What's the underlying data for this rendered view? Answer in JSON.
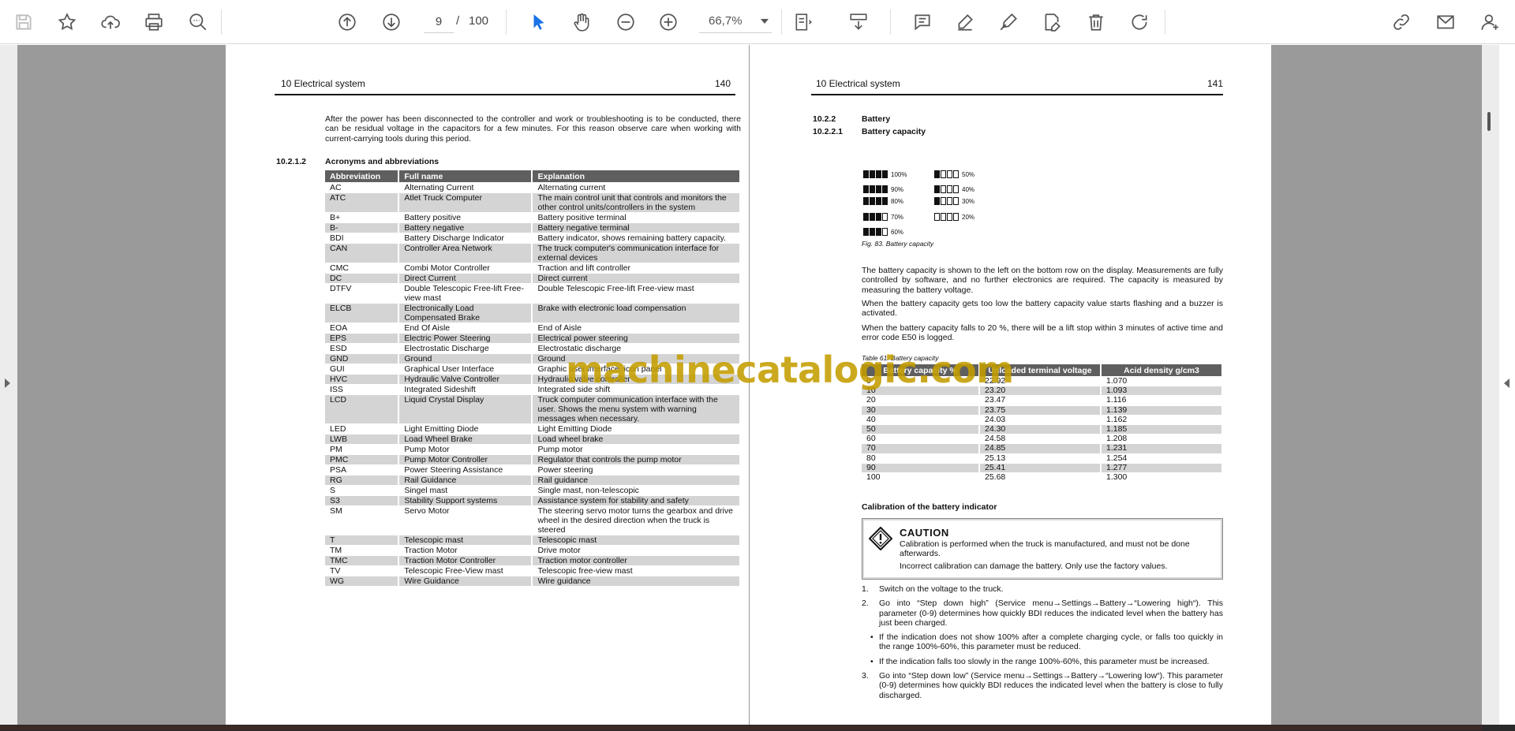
{
  "toolbar": {
    "left_icons": [
      "save-icon",
      "star-icon",
      "cloud-upload-icon",
      "print-icon",
      "zoom-search-icon"
    ],
    "nav_icons": [
      "page-up-icon",
      "page-down-icon"
    ],
    "page_current": "9",
    "page_sep": "/",
    "page_total": "100",
    "tool_icons": [
      "select-cursor-icon",
      "hand-icon",
      "zoom-out-icon",
      "zoom-in-icon"
    ],
    "zoom": "66,7%",
    "right_icons": [
      "fit-page-icon",
      "scroll-mode-icon",
      "comment-icon",
      "highlight-icon",
      "sign-icon",
      "edit-text-icon",
      "delete-icon",
      "rotate-icon",
      "share-link-icon",
      "email-icon",
      "add-user-icon"
    ],
    "accent_color": "#1a73e8"
  },
  "watermark": "machinecatalogic.com",
  "left_page": {
    "header_title": "10 Electrical system",
    "header_page": "140",
    "intro": "After the power has been disconnected to the controller and work or troubleshooting is to be conducted, there can be residual voltage in the capacitors for a few minutes. For this reason observe care when working with current-carrying tools during this period.",
    "section_num": "10.2.1.2",
    "section_title": "Acronyms and abbreviations",
    "table_headers": [
      "Abbreviation",
      "Full name",
      "Explanation"
    ],
    "table_rows": [
      [
        "AC",
        "Alternating Current",
        "Alternating current"
      ],
      [
        "ATC",
        "Atlet Truck Computer",
        "The main control unit that controls and monitors the other control units/controllers in the system"
      ],
      [
        "B+",
        "Battery positive",
        "Battery positive terminal"
      ],
      [
        "B-",
        "Battery negative",
        "Battery negative terminal"
      ],
      [
        "BDI",
        "Battery Discharge Indicator",
        "Battery indicator, shows remaining battery capacity."
      ],
      [
        "CAN",
        "Controller Area Network",
        "The truck computer's communication interface for external devices"
      ],
      [
        "CMC",
        "Combi Motor Controller",
        "Traction and lift controller"
      ],
      [
        "DC",
        "Direct Current",
        "Direct current"
      ],
      [
        "DTFV",
        "Double Telescopic Free-lift Free-view mast",
        "Double Telescopic Free-lift Free-view mast"
      ],
      [
        "ELCB",
        "Electronically Load Compensated Brake",
        "Brake with electronic load compensation"
      ],
      [
        "EOA",
        "End Of Aisle",
        "End of Aisle"
      ],
      [
        "EPS",
        "Electric Power Steering",
        "Electrical power steering"
      ],
      [
        "ESD",
        "Electrostatic Discharge",
        "Electrostatic discharge"
      ],
      [
        "GND",
        "Ground",
        "Ground"
      ],
      [
        "GUI",
        "Graphical User Interface",
        "Graphic user interface, icon panel"
      ],
      [
        "HVC",
        "Hydraulic Valve Controller",
        "Hydraulic valve controller"
      ],
      [
        "ISS",
        "Integrated Sideshift",
        "Integrated side shift"
      ],
      [
        "LCD",
        "Liquid Crystal Display",
        "Truck computer communication interface with the user. Shows the menu system with warning messages when necessary."
      ],
      [
        "LED",
        "Light Emitting Diode",
        "Light Emitting Diode"
      ],
      [
        "LWB",
        "Load Wheel Brake",
        "Load wheel brake"
      ],
      [
        "PM",
        "Pump Motor",
        "Pump motor"
      ],
      [
        "PMC",
        "Pump Motor Controller",
        "Regulator that controls the pump motor"
      ],
      [
        "PSA",
        "Power Steering Assistance",
        "Power steering"
      ],
      [
        "RG",
        "Rail Guidance",
        "Rail guidance"
      ],
      [
        "S",
        "Singel mast",
        "Single mast, non-telescopic"
      ],
      [
        "S3",
        "Stability Support systems",
        "Assistance system for stability and safety"
      ],
      [
        "SM",
        "Servo Motor",
        "The steering servo motor turns the gearbox and drive wheel in the desired direction when the truck is steered"
      ],
      [
        "T",
        "Telescopic mast",
        "Telescopic mast"
      ],
      [
        "TM",
        "Traction Motor",
        "Drive motor"
      ],
      [
        "TMC",
        "Traction Motor Controller",
        "Traction motor controller"
      ],
      [
        "TV",
        "Telescopic Free-View mast",
        "Telescopic free-view mast"
      ],
      [
        "WG",
        "Wire Guidance",
        "Wire guidance"
      ]
    ]
  },
  "right_page": {
    "header_title": "10 Electrical system",
    "header_page": "141",
    "sec1_num": "10.2.2",
    "sec1_title": "Battery",
    "sec2_num": "10.2.2.1",
    "sec2_title": "Battery capacity",
    "battery_levels": [
      {
        "label": "100%",
        "filled": 4
      },
      {
        "label": "90%",
        "filled": 4
      },
      {
        "label": "80%",
        "filled": 4
      },
      {
        "label": "70%",
        "filled": 3
      },
      {
        "label": "60%",
        "filled": 3
      },
      {
        "label": "50%",
        "filled": 1
      },
      {
        "label": "40%",
        "filled": 1
      },
      {
        "label": "30%",
        "filled": 1
      },
      {
        "label": "20%",
        "filled": 0
      }
    ],
    "fig_caption": "Fig. 83. Battery capacity",
    "para1": "The battery capacity is shown to the left on the bottom row on the display. Measurements are fully controlled by software, and no further electronics are required. The capacity is measured by measuring the battery voltage.",
    "para2": "When the battery capacity gets too low the battery capacity value starts flashing and a buzzer is activated.",
    "para3": "When the battery capacity falls to 20 %, there will be a lift stop within 3 minutes of active time and error code E50 is logged.",
    "table_caption": "Table 61. Battery capacity",
    "table_headers": [
      "Battery capacity %",
      "Unloaded terminal voltage",
      "Acid density g/cm3"
    ],
    "table_rows": [
      [
        "0",
        "22.92",
        "1.070"
      ],
      [
        "10",
        "23.20",
        "1.093"
      ],
      [
        "20",
        "23.47",
        "1.116"
      ],
      [
        "30",
        "23.75",
        "1.139"
      ],
      [
        "40",
        "24.03",
        "1.162"
      ],
      [
        "50",
        "24.30",
        "1.185"
      ],
      [
        "60",
        "24.58",
        "1.208"
      ],
      [
        "70",
        "24.85",
        "1.231"
      ],
      [
        "80",
        "25.13",
        "1.254"
      ],
      [
        "90",
        "25.41",
        "1.277"
      ],
      [
        "100",
        "25.68",
        "1.300"
      ]
    ],
    "calib_title": "Calibration of the battery indicator",
    "caution_title": "CAUTION",
    "caution_line1": "Calibration is performed when the truck is manufactured, and must not be done afterwards.",
    "caution_line2": "Incorrect calibration can damage the battery. Only use the factory values.",
    "step1_num": "1.",
    "step1": "Switch on the voltage to the truck.",
    "step2_num": "2.",
    "step2": "Go into “Step down high” (Service menu→Settings→Battery→“Lowering high“). This parameter (0-9) determines how quickly BDI reduces the indicated level when the battery has just been charged.",
    "bullet1": "If the indication does not show 100% after a complete charging cycle, or falls too quickly in the range 100%-60%, this parameter must be reduced.",
    "bullet2": "If the indication falls too slowly in the range 100%-60%, this parameter must be increased.",
    "step3_num": "3.",
    "step3": "Go into “Step down low” (Service menu→Settings→Battery→“Lowering low“). This parameter (0-9) determines how quickly BDI reduces the indicated level when the battery is close to fully discharged."
  }
}
